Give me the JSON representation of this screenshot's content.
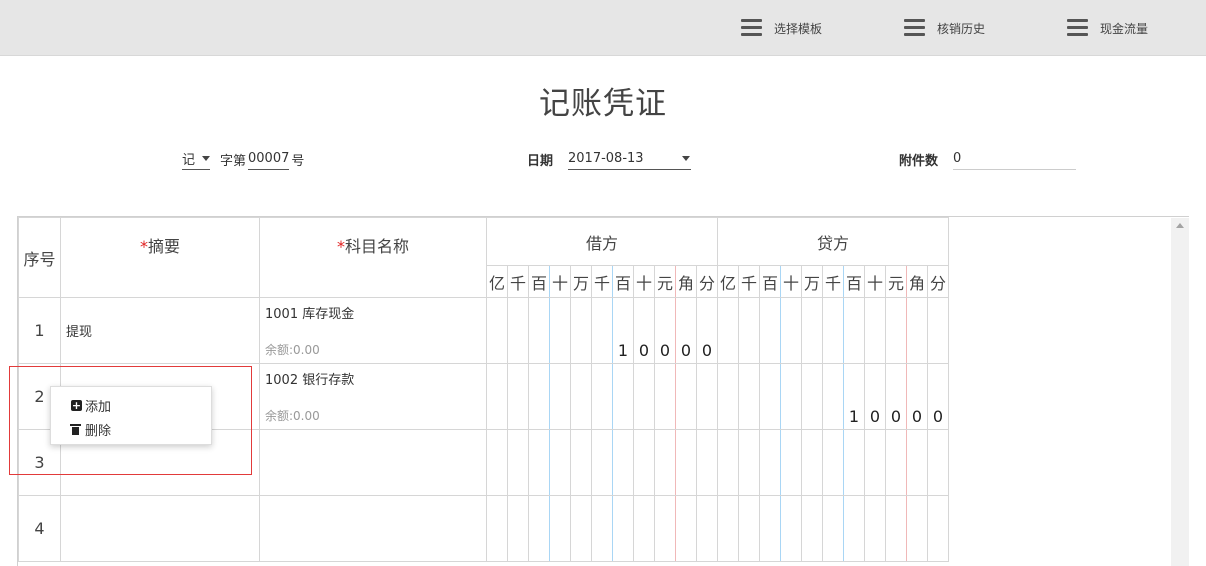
{
  "toolbar": {
    "items": [
      {
        "label": "选择模板",
        "icon": "menu-icon"
      },
      {
        "label": "核销历史",
        "icon": "menu-icon"
      },
      {
        "label": "现金流量",
        "icon": "menu-icon"
      }
    ]
  },
  "title": "记账凭证",
  "voucher": {
    "word": "记",
    "prefix": "字第",
    "number": "00007",
    "suffix": "号",
    "date_label": "日期",
    "date_value": "2017-08-13",
    "attach_label": "附件数",
    "attach_value": "0"
  },
  "table": {
    "headers": {
      "index": "序号",
      "summary": "摘要",
      "subject": "科目名称",
      "debit": "借方",
      "credit": "贷方",
      "required_mark": "*"
    },
    "digit_units": [
      "亿",
      "千",
      "百",
      "十",
      "万",
      "千",
      "百",
      "十",
      "元",
      "角",
      "分"
    ],
    "rows": [
      {
        "index": "1",
        "summary": "提现",
        "subject": "1001 库存现金",
        "balance": "余额:0.00",
        "debit": [
          "",
          "",
          "",
          "",
          "",
          "",
          "1",
          "0",
          "0",
          "0",
          "0"
        ],
        "credit": [
          "",
          "",
          "",
          "",
          "",
          "",
          "",
          "",
          "",
          "",
          ""
        ]
      },
      {
        "index": "2",
        "summary": "",
        "subject": "1002 银行存款",
        "balance": "余额:0.00",
        "debit": [
          "",
          "",
          "",
          "",
          "",
          "",
          "",
          "",
          "",
          "",
          ""
        ],
        "credit": [
          "",
          "",
          "",
          "",
          "",
          "",
          "1",
          "0",
          "0",
          "0",
          "0"
        ]
      },
      {
        "index": "3",
        "summary": "",
        "subject": "",
        "balance": "",
        "debit": [
          "",
          "",
          "",
          "",
          "",
          "",
          "",
          "",
          "",
          "",
          ""
        ],
        "credit": [
          "",
          "",
          "",
          "",
          "",
          "",
          "",
          "",
          "",
          "",
          ""
        ]
      },
      {
        "index": "4",
        "summary": "",
        "subject": "",
        "balance": "",
        "debit": [
          "",
          "",
          "",
          "",
          "",
          "",
          "",
          "",
          "",
          "",
          ""
        ],
        "credit": [
          "",
          "",
          "",
          "",
          "",
          "",
          "",
          "",
          "",
          "",
          ""
        ]
      }
    ]
  },
  "context_menu": {
    "add": "添加",
    "delete": "删除"
  },
  "colors": {
    "required": "#e02020",
    "selection_border": "#e23a3a",
    "toolbar_bg": "#e6e6e6"
  }
}
